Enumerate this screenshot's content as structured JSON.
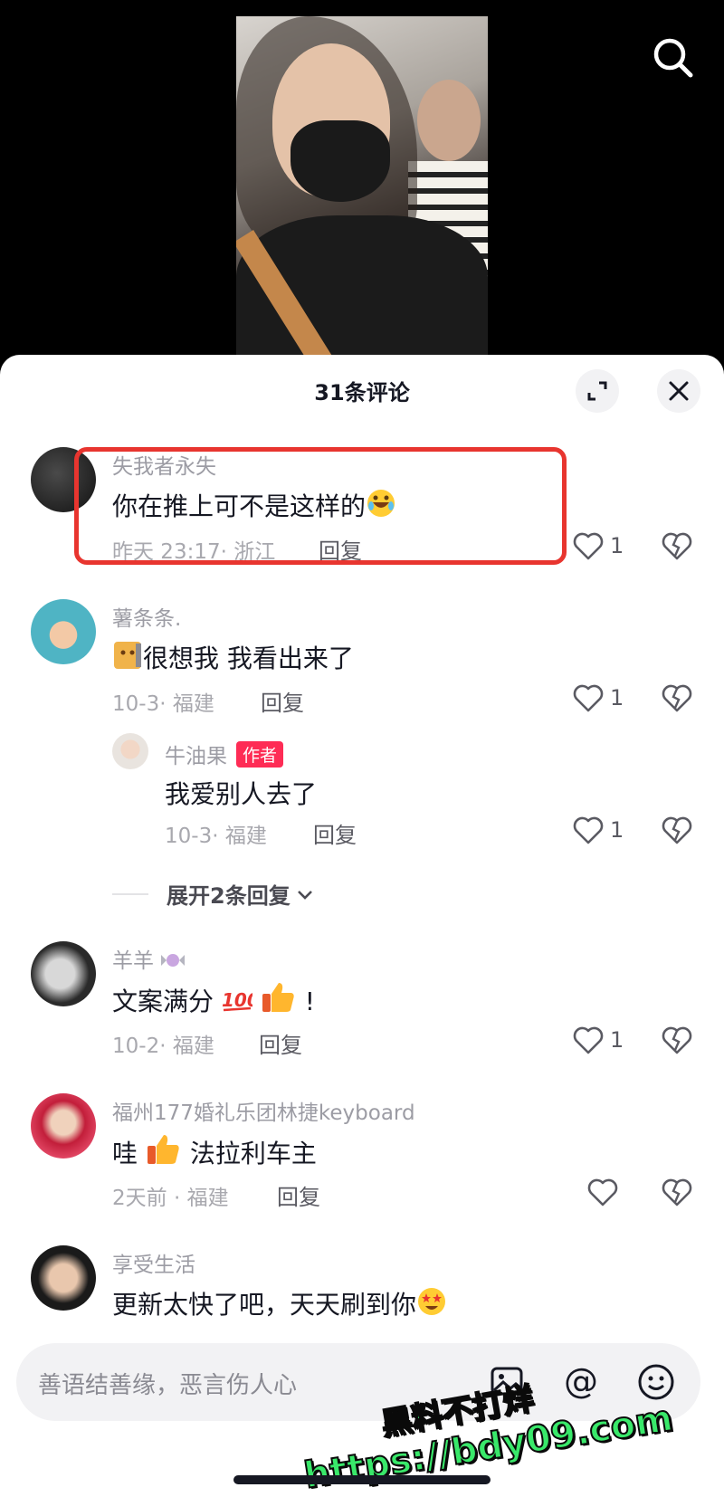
{
  "video": {
    "has_search": true
  },
  "sheet": {
    "title": "31条评论"
  },
  "comments": [
    {
      "user": "失我者永失",
      "text": "你在推上可不是这样的",
      "emoji": "rofl",
      "time": "昨天 23:17· 浙江",
      "reply": "回复",
      "likes": "1",
      "highlighted": true
    },
    {
      "user": "薯条条.",
      "text": "很想我 我看出来了",
      "emoji": "sticker-cat",
      "time": "10-3· 福建",
      "reply": "回复",
      "likes": "1"
    },
    {
      "user": "牛油果",
      "badge": "作者",
      "text": "我爱别人去了",
      "time": "10-3· 福建",
      "reply": "回复",
      "likes": "1",
      "is_reply": true
    },
    {
      "user": "羊羊",
      "text_before": "文案满分",
      "text_after": "!",
      "emoji": "hundred, thumbs-up",
      "time": "10-2· 福建",
      "reply": "回复",
      "likes": "1"
    },
    {
      "user": "福州177婚礼乐团林捷keyboard",
      "text_before": "哇",
      "text_after": "法拉利车主",
      "emoji": "thumbs-up",
      "time": "2天前 · 福建",
      "reply": "回复",
      "likes": ""
    },
    {
      "user": "享受生活",
      "text": "更新太快了吧，天天刷到你",
      "emoji": "star-struck",
      "time": "",
      "reply": "",
      "likes": ""
    }
  ],
  "expand_replies": {
    "label": "展开2条回复"
  },
  "input": {
    "placeholder": "善语结善缘，恶言伤人心"
  },
  "watermark": {
    "line1": "黑料不打烊",
    "line2": "https://bdy09.com"
  },
  "colors": {
    "accent_red": "#fe2c55",
    "highlight": "#e8352f",
    "watermark": "#39e86a"
  }
}
